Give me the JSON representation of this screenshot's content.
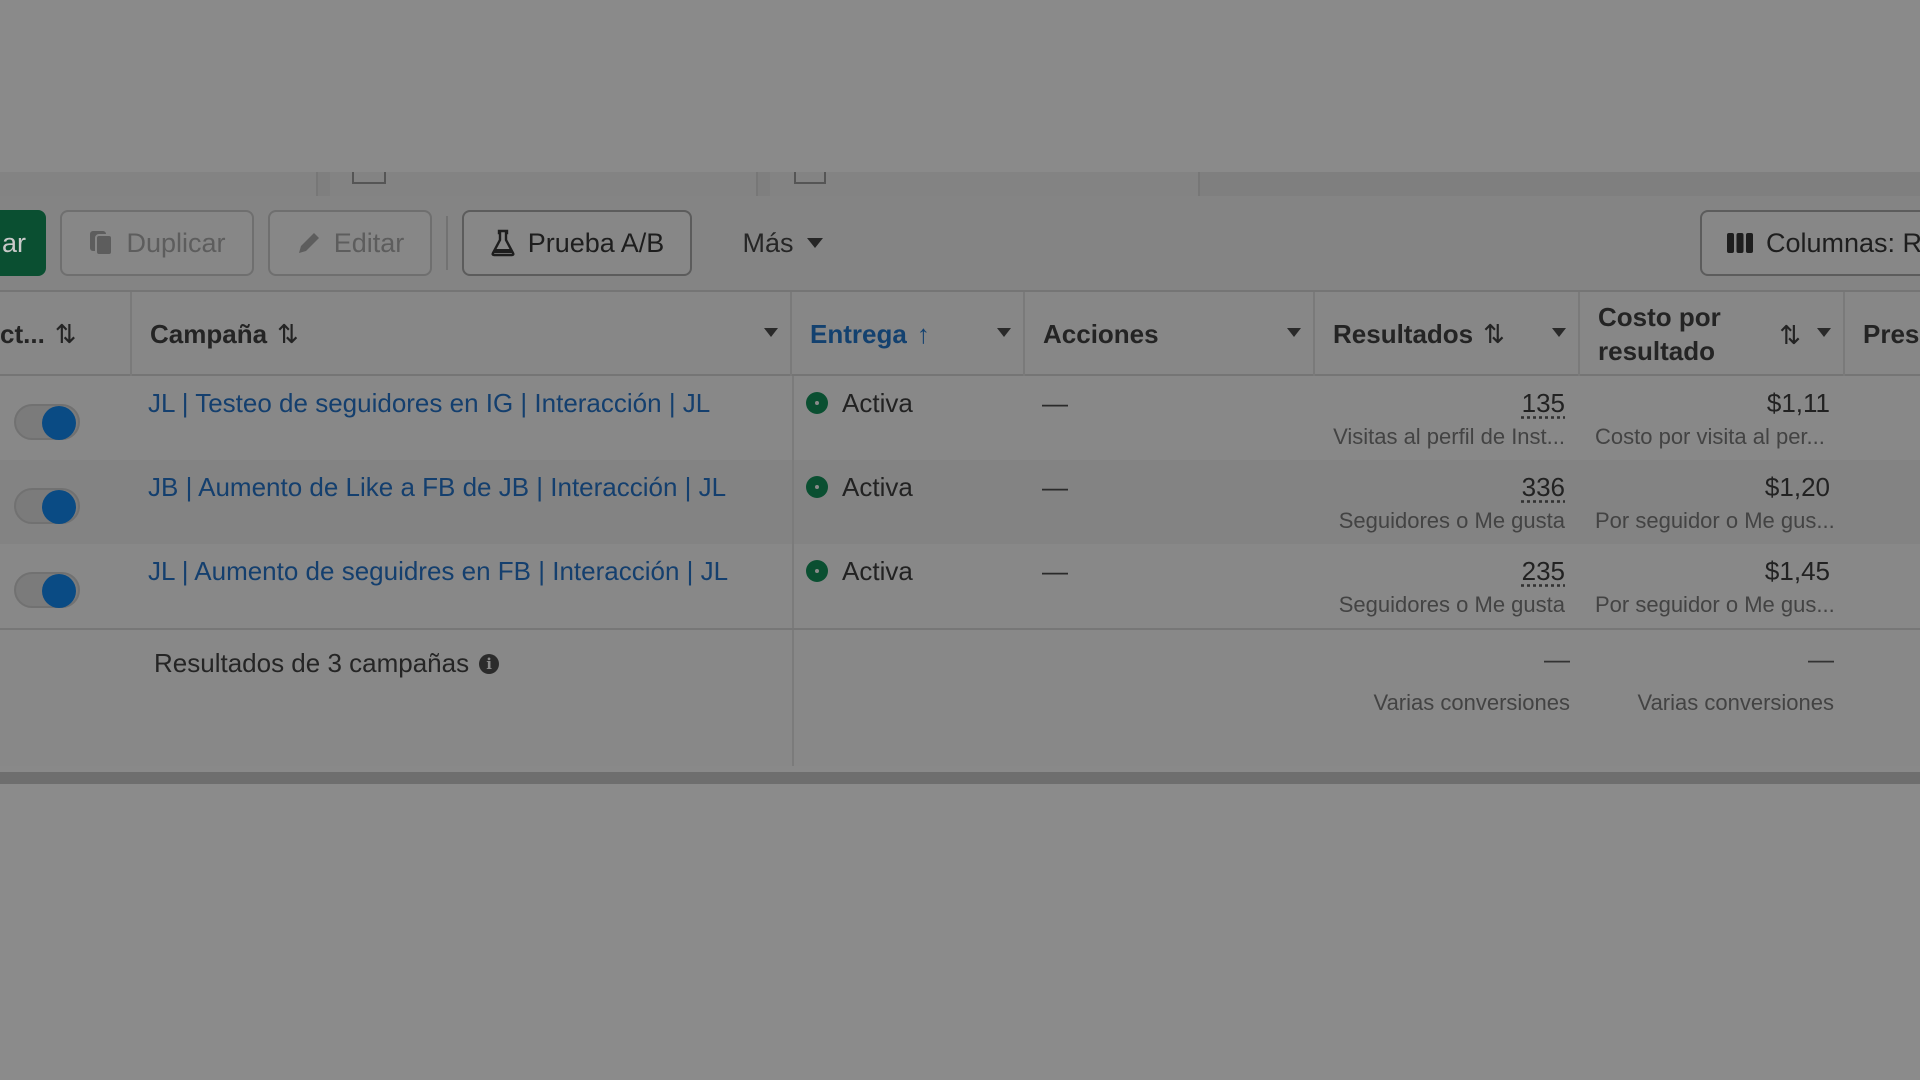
{
  "toolbar": {
    "create_label": "ar",
    "duplicate_label": "Duplicar",
    "edit_label": "Editar",
    "ab_test_label": "Prueba A/B",
    "more_label": "Más",
    "columns_label": "Columnas: Re"
  },
  "table": {
    "headers": {
      "activation": "ct...",
      "campaign": "Campaña",
      "delivery": "Entrega",
      "actions": "Acciones",
      "results": "Resultados",
      "cost_line1": "Costo por",
      "cost_line2": "resultado",
      "budget": "Pres"
    },
    "rows": [
      {
        "campaign": "JL | Testeo de seguidores en IG | Interacción | JL",
        "status": "Activa",
        "actions": "—",
        "result_value": "135",
        "result_type": "Visitas al perfil de Inst...",
        "cost_value": "$1,11",
        "cost_type": "Costo por visita al per..."
      },
      {
        "campaign": "JB | Aumento de Like a FB de JB | Interacción | JL",
        "status": "Activa",
        "actions": "—",
        "result_value": "336",
        "result_type": "Seguidores o Me gusta",
        "cost_value": "$1,20",
        "cost_type": "Por seguidor o Me gus..."
      },
      {
        "campaign": "JL | Aumento de seguidres en FB | Interacción | JL",
        "status": "Activa",
        "actions": "—",
        "result_value": "235",
        "result_type": "Seguidores o Me gusta",
        "cost_value": "$1,45",
        "cost_type": "Por seguidor o Me gus..."
      }
    ],
    "summary": {
      "label": "Resultados de 3 campañas",
      "results_value": "—",
      "results_sub": "Varias conversiones",
      "cost_value": "—",
      "cost_sub": "Varias conversiones"
    }
  },
  "colors": {
    "accent_green": "#0a4f31",
    "link_blue": "#143f6e",
    "toggle_blue": "#0a4b84"
  }
}
